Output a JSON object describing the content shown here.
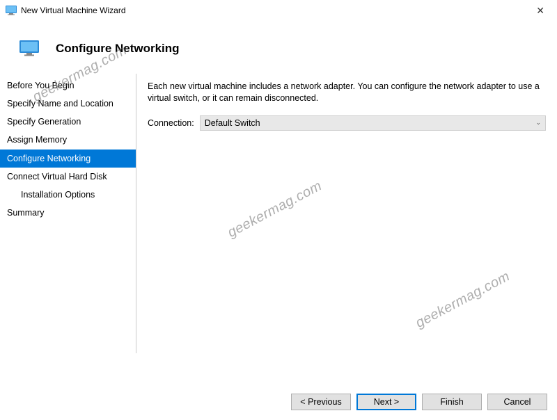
{
  "titlebar": {
    "title": "New Virtual Machine Wizard"
  },
  "header": {
    "title": "Configure Networking"
  },
  "sidebar": {
    "items": [
      {
        "label": "Before You Begin"
      },
      {
        "label": "Specify Name and Location"
      },
      {
        "label": "Specify Generation"
      },
      {
        "label": "Assign Memory"
      },
      {
        "label": "Configure Networking"
      },
      {
        "label": "Connect Virtual Hard Disk"
      },
      {
        "label": "Installation Options"
      },
      {
        "label": "Summary"
      }
    ]
  },
  "main": {
    "description": "Each new virtual machine includes a network adapter. You can configure the network adapter to use a virtual switch, or it can remain disconnected.",
    "connection_label": "Connection:",
    "connection_value": "Default Switch"
  },
  "footer": {
    "previous": "< Previous",
    "next": "Next >",
    "finish": "Finish",
    "cancel": "Cancel"
  },
  "watermark": "geekermag.com"
}
